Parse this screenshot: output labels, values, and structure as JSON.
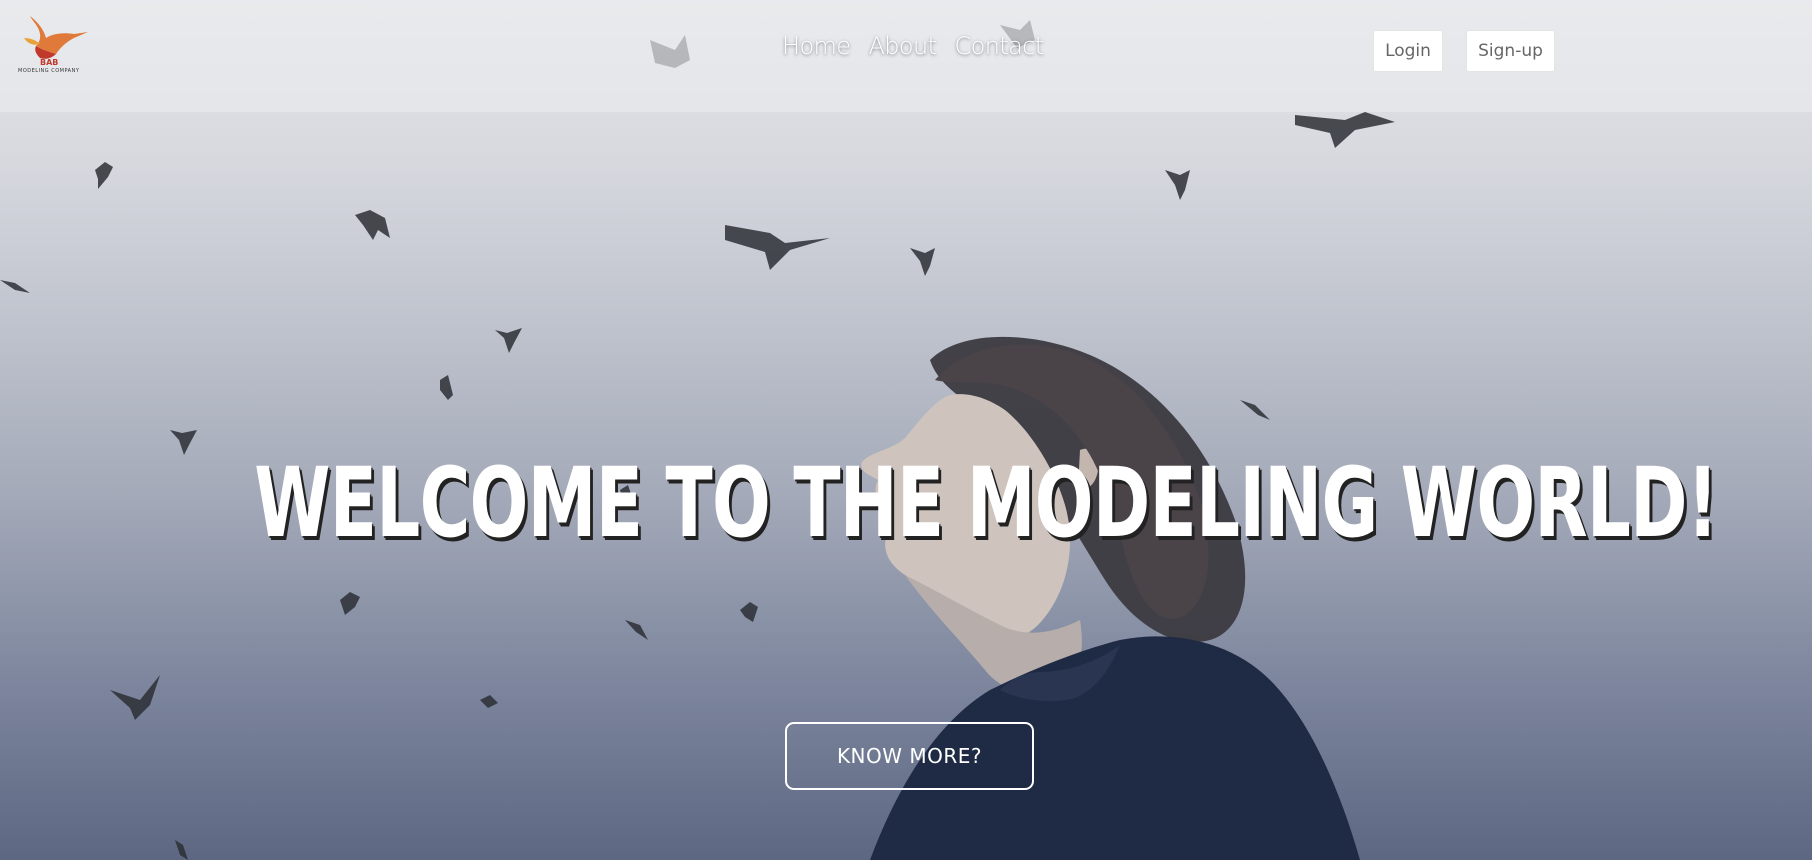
{
  "brand": {
    "logo_icon": "hummingbird-logo-icon",
    "name": "BAB",
    "tagline": "MODELING COMPANY"
  },
  "nav": {
    "links": [
      {
        "label": "Home"
      },
      {
        "label": "About"
      },
      {
        "label": "Contact"
      }
    ]
  },
  "auth": {
    "login_label": "Login",
    "signup_label": "Sign-up"
  },
  "hero": {
    "headline": "WELCOME TO THE MODELING WORLD!",
    "cta_label": "KNOW MORE?",
    "background_image": "woman-looking-up-with-flying-birds"
  },
  "colors": {
    "nav_overlay": "#ebecee",
    "text_white": "#ffffff",
    "button_text": "#666666",
    "sky_top": "#e6e7ea",
    "sky_bottom": "#5d6782"
  }
}
